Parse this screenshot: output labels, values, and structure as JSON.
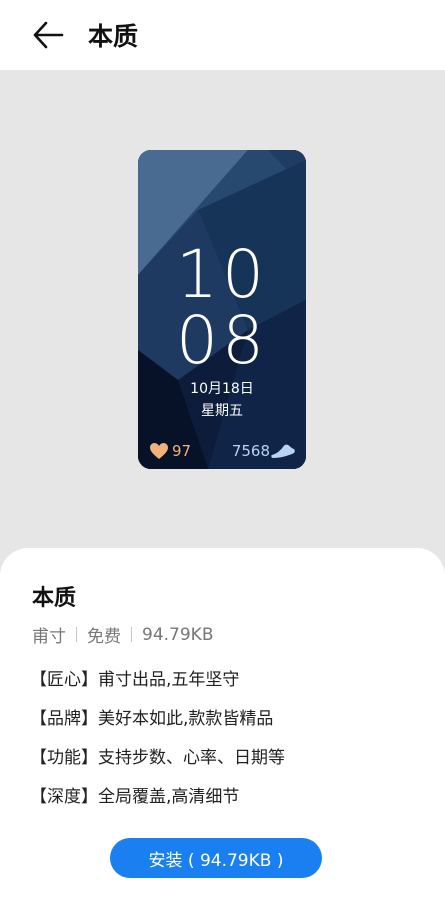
{
  "header": {
    "title": "本质"
  },
  "watchface": {
    "hour": "10",
    "minute": "08",
    "date": "10月18日",
    "weekday": "星期五",
    "heart_rate": "97",
    "steps": "7568"
  },
  "details": {
    "name": "本质",
    "author": "甫寸",
    "price": "免费",
    "size": "94.79KB",
    "description": [
      "【匠心】甫寸出品,五年坚守",
      "【品牌】美好本如此,款款皆精品",
      "【功能】支持步数、心率、日期等",
      "【深度】全局覆盖,高清细节"
    ]
  },
  "install_button": {
    "label": "安装 ( 94.79KB )"
  },
  "colors": {
    "accent": "#1a7ff0",
    "heart": "#f0b27a",
    "steps": "#b8d3f5"
  }
}
